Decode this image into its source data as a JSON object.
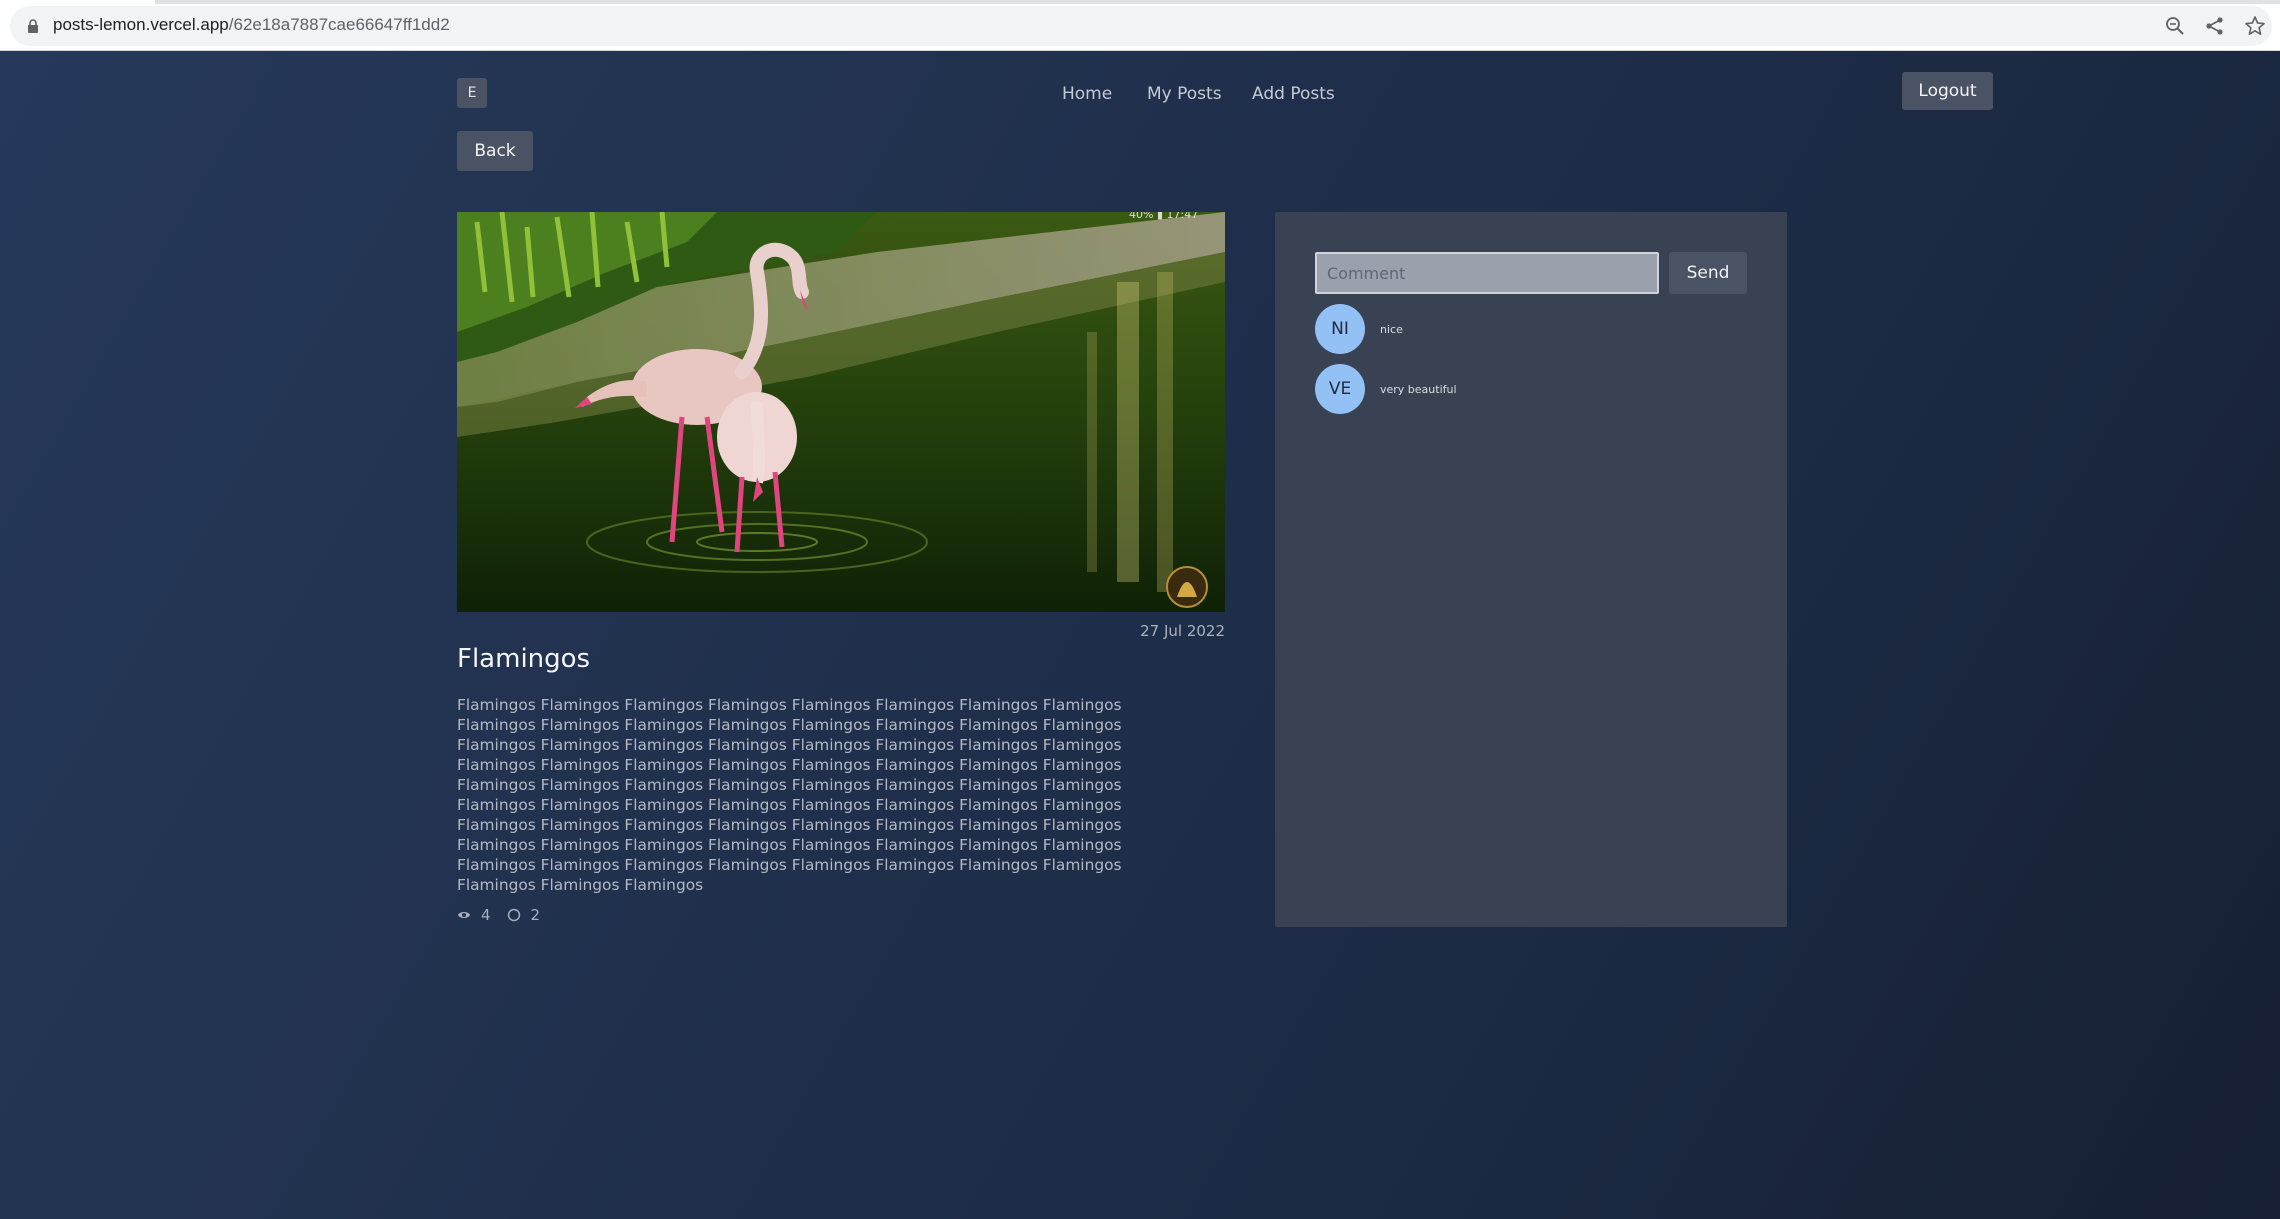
{
  "browser": {
    "url_host": "posts-lemon.vercel.app",
    "url_path": "/62e18a7887cae66647ff1dd2",
    "icons": [
      "lock-icon",
      "zoom-icon",
      "share-icon",
      "bookmark-star-icon"
    ]
  },
  "header": {
    "logo_letter": "E",
    "nav": [
      "Home",
      "My Posts",
      "Add Posts"
    ],
    "logout_label": "Logout"
  },
  "back_label": "Back",
  "post": {
    "image_alt": "Two pink flamingos wading in green water",
    "date": "27 Jul 2022",
    "title": "Flamingos",
    "body": "Flamingos Flamingos Flamingos Flamingos Flamingos Flamingos Flamingos Flamingos Flamingos Flamingos Flamingos Flamingos Flamingos Flamingos Flamingos Flamingos Flamingos Flamingos Flamingos Flamingos Flamingos Flamingos Flamingos Flamingos Flamingos Flamingos Flamingos Flamingos Flamingos Flamingos Flamingos Flamingos Flamingos Flamingos Flamingos Flamingos Flamingos Flamingos Flamingos Flamingos Flamingos Flamingos Flamingos Flamingos Flamingos Flamingos Flamingos Flamingos Flamingos Flamingos Flamingos Flamingos Flamingos Flamingos Flamingos Flamingos Flamingos Flamingos Flamingos Flamingos Flamingos Flamingos Flamingos Flamingos Flamingos Flamingos Flamingos Flamingos Flamingos Flamingos Flamingos Flamingos Flamingos Flamingos Flamingos",
    "views": "4",
    "comments_count": "2"
  },
  "comments": {
    "placeholder": "Comment",
    "send_label": "Send",
    "items": [
      {
        "initials": "NI",
        "text": "nice"
      },
      {
        "initials": "VE",
        "text": "very beautiful"
      }
    ]
  },
  "colors": {
    "background": "#1f2f4b",
    "panel": "#394253",
    "button": "#4a5364",
    "avatar": "#93c0f5"
  }
}
